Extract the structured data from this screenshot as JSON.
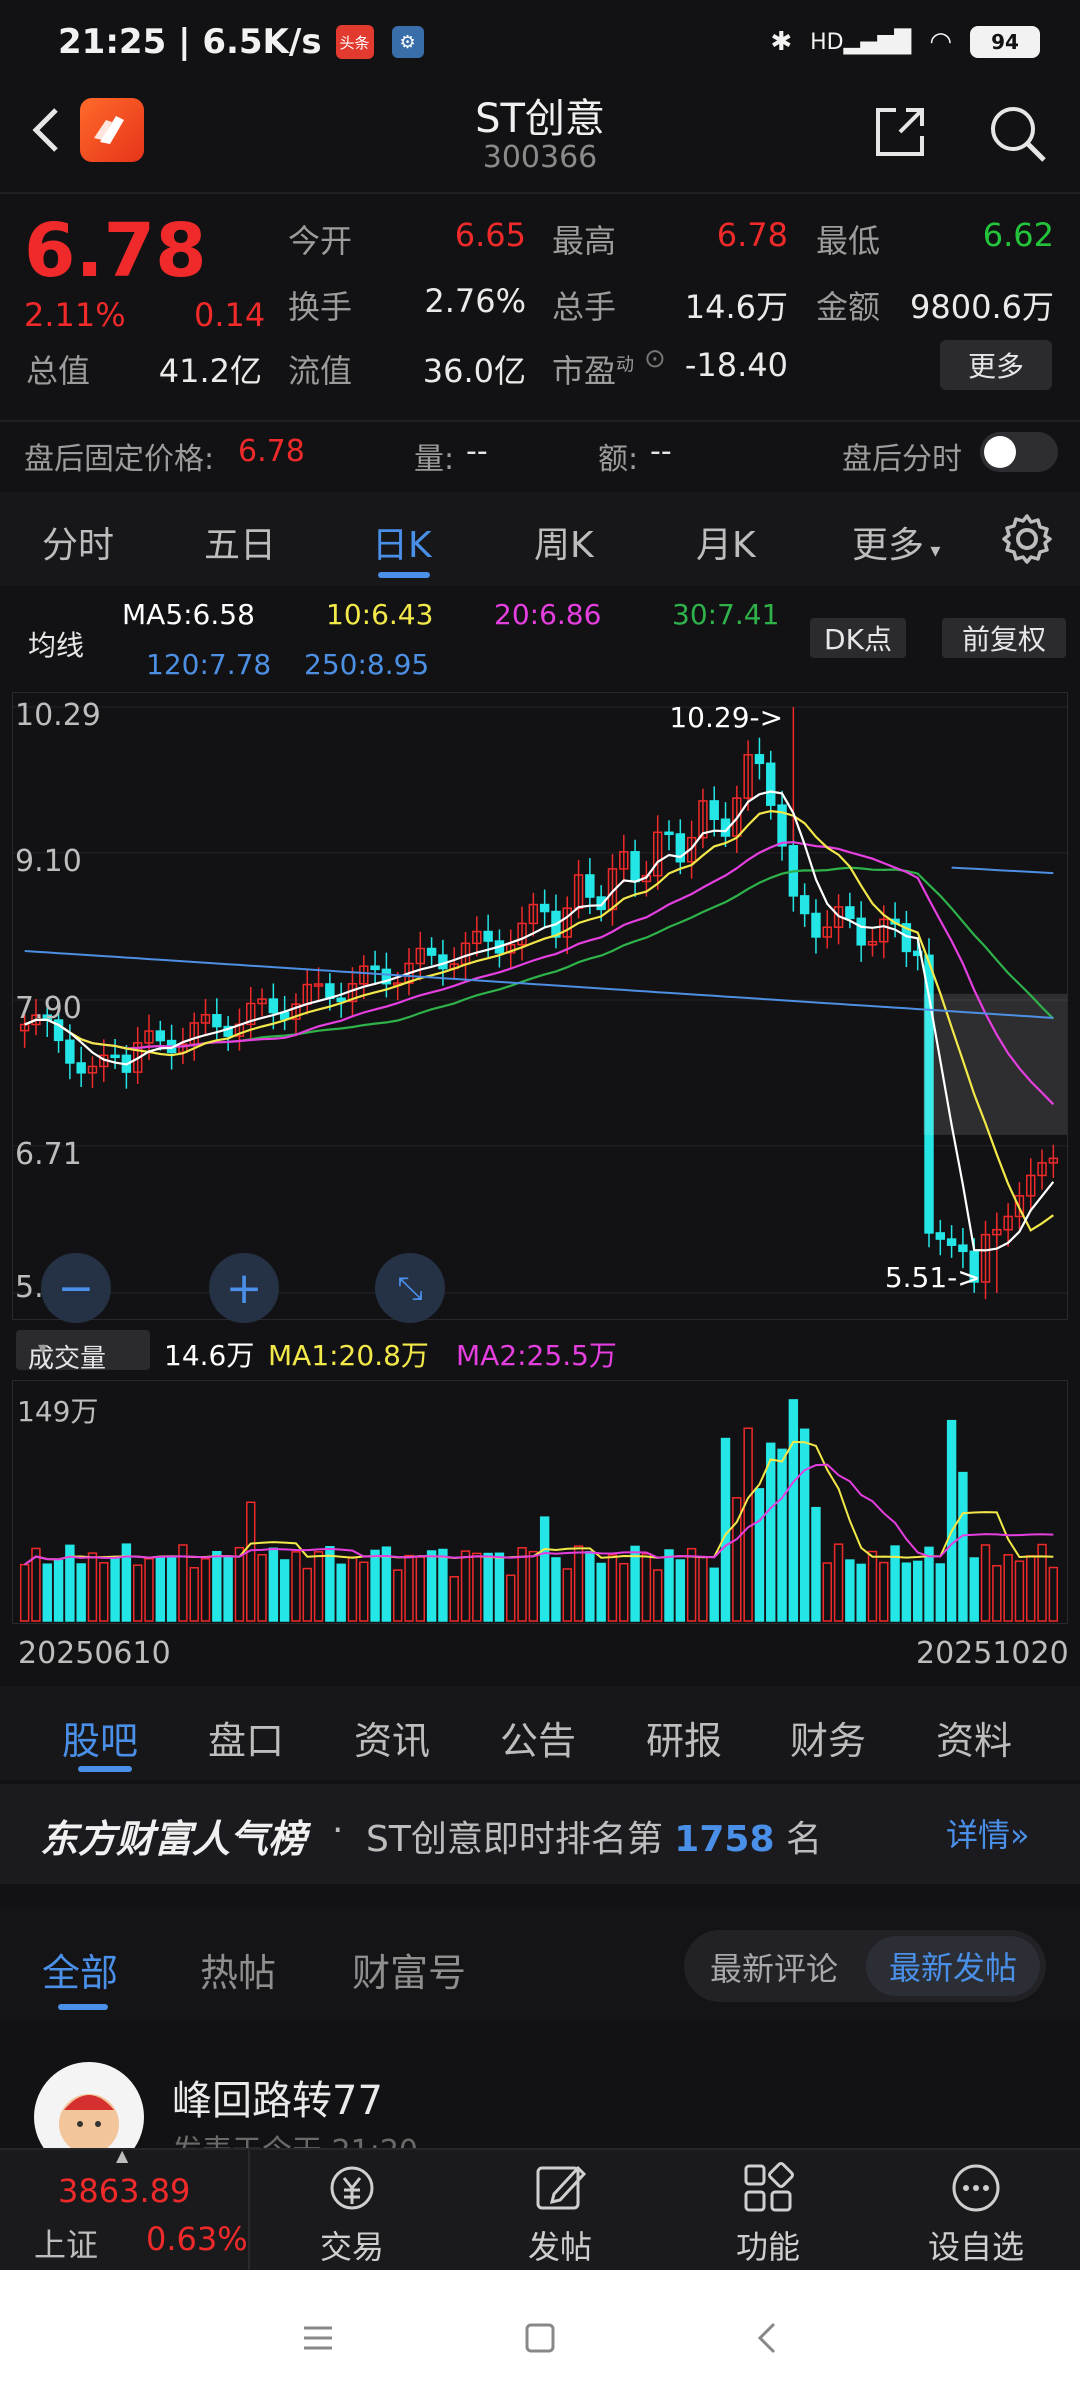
{
  "status": {
    "time": "21:25",
    "speed": "6.5K/s",
    "app_badge": "头条",
    "battery": "94",
    "net": "HD"
  },
  "header": {
    "title": "ST创意",
    "code": "300366"
  },
  "quote": {
    "price": "6.78",
    "pct": "2.11%",
    "chg": "0.14",
    "rows": [
      {
        "l1": "今开",
        "v1": "6.65",
        "l2": "最高",
        "v2": "6.78",
        "l3": "最低",
        "v3": "6.62"
      },
      {
        "l1": "换手",
        "v1": "2.76%",
        "l2": "总手",
        "v2": "14.6万",
        "l3": "金额",
        "v3": "9800.6万"
      },
      {
        "l1": "总值",
        "v1": "41.2亿",
        "l2": "流值",
        "v2": "36.0亿",
        "l3": "市盈",
        "v3": "-18.40"
      }
    ],
    "pe_sup": "动",
    "more": "更多"
  },
  "after_hours": {
    "label": "盘后固定价格:",
    "price": "6.78",
    "vol_label": "量:",
    "vol": "--",
    "amt_label": "额:",
    "amt": "--",
    "toggle_label": "盘后分时"
  },
  "period_tabs": [
    "分时",
    "五日",
    "日K",
    "周K",
    "月K",
    "更多"
  ],
  "ma_legend": {
    "title": "均线",
    "ma5": "MA5:6.58",
    "ma10": "10:6.43",
    "ma20": "20:6.86",
    "ma30": "30:7.41",
    "ma120": "120:7.78",
    "ma250": "250:8.95",
    "dk": "DK点",
    "fq": "前复权"
  },
  "chart_data": {
    "type": "candlestick",
    "y_labels": [
      "10.29",
      "9.10",
      "7.90",
      "6.71",
      "5.51"
    ],
    "ylim": [
      5.51,
      10.29
    ],
    "max_marker": "10.29->",
    "min_marker": "5.51->",
    "x_start": "20250610",
    "x_end": "20251020",
    "colors": {
      "up": "#f02a2a",
      "down": "#24e6e6",
      "ma5": "#ffffff",
      "ma10": "#f3e84a",
      "ma20": "#e53fe0",
      "ma30": "#2fb24a",
      "ma120": "#4d8fe3",
      "ma250": "#4d8fe3"
    },
    "volume": {
      "label": "成交量",
      "current": "14.6万",
      "ma1": "MA1:20.8万",
      "ma2": "MA2:25.5万",
      "max_label": "149万"
    }
  },
  "sub_tabs": [
    "股吧",
    "盘口",
    "资讯",
    "公告",
    "研报",
    "财务",
    "资料"
  ],
  "rank": {
    "brand": "东方财富人气榜",
    "sep": "·",
    "prefix": "ST创意即时排名第",
    "num": "1758",
    "suffix": "名",
    "detail": "详情"
  },
  "feed_tabs": [
    "全部",
    "热帖",
    "财富号"
  ],
  "sort": [
    "最新评论",
    "最新发帖"
  ],
  "post": {
    "name": "峰回路转77",
    "time": "发表于今天 21:20"
  },
  "bottom": {
    "index_val": "3863.89",
    "index_name": "上证",
    "index_pct": "0.63%",
    "items": [
      "交易",
      "发帖",
      "功能",
      "设自选"
    ]
  }
}
